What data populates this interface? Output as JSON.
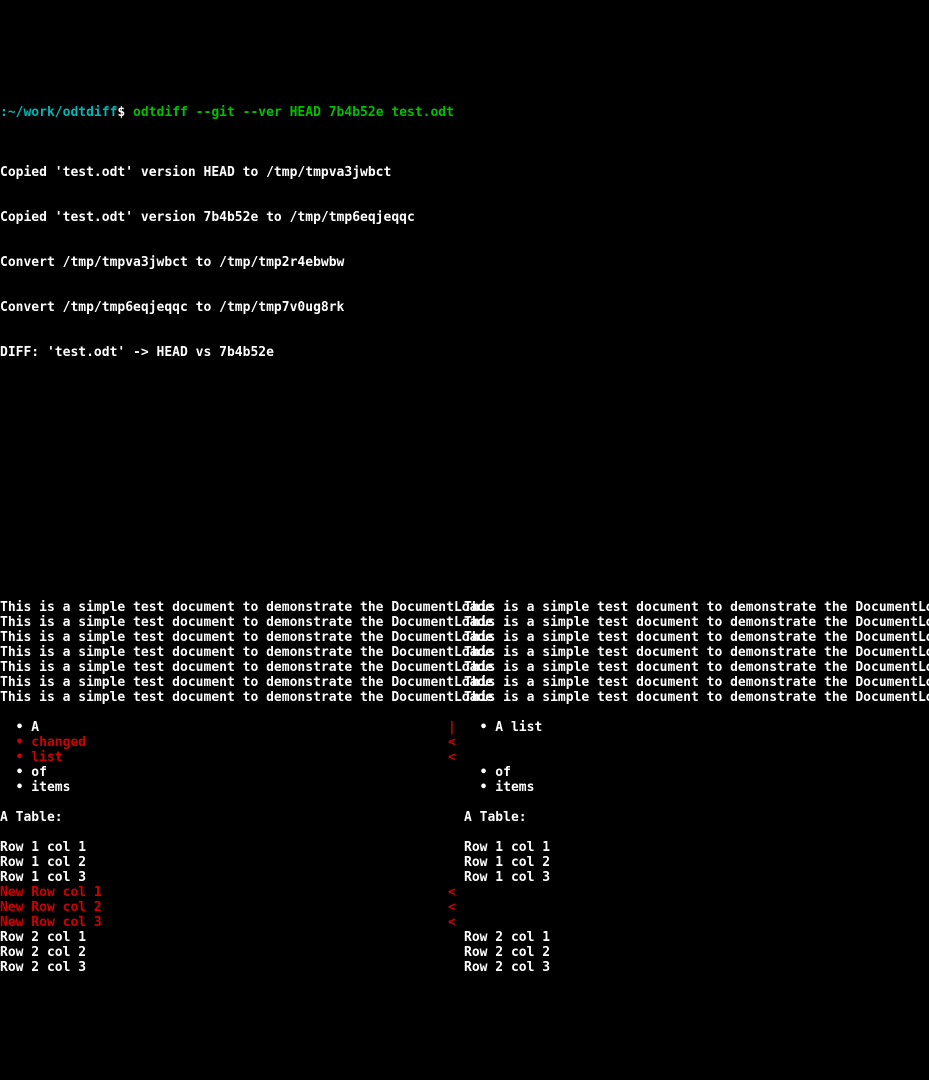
{
  "prompt": {
    "path": ":~/work/odtdiff",
    "dollar": "$",
    "command": " odtdiff --git --ver HEAD 7b4b52e test.odt"
  },
  "header": [
    "Copied 'test.odt' version HEAD to /tmp/tmpva3jwbct",
    "Copied 'test.odt' version 7b4b52e to /tmp/tmp6eqjeqqc",
    "Convert /tmp/tmpva3jwbct to /tmp/tmp2r4ebwbw",
    "Convert /tmp/tmp6eqjeqqc to /tmp/tmp7v0ug8rk",
    "DIFF: 'test.odt' -> HEAD vs 7b4b52e"
  ],
  "diff": {
    "rows": [
      {
        "left": "This is a simple test document to demonstrate the DocumentLoade",
        "sep": " ",
        "right": "This is a simple test document to demonstrate the DocumentLoade"
      },
      {
        "left": "This is a simple test document to demonstrate the DocumentLoade",
        "sep": " ",
        "right": "This is a simple test document to demonstrate the DocumentLoade"
      },
      {
        "left": "This is a simple test document to demonstrate the DocumentLoade",
        "sep": " ",
        "right": "This is a simple test document to demonstrate the DocumentLoade"
      },
      {
        "left": "This is a simple test document to demonstrate the DocumentLoade",
        "sep": " ",
        "right": "This is a simple test document to demonstrate the DocumentLoade"
      },
      {
        "left": "This is a simple test document to demonstrate the DocumentLoade",
        "sep": " ",
        "right": "This is a simple test document to demonstrate the DocumentLoade"
      },
      {
        "left": "This is a simple test document to demonstrate the DocumentLoade",
        "sep": " ",
        "right": "This is a simple test document to demonstrate the DocumentLoade"
      },
      {
        "left": "This is a simple test document to demonstrate the DocumentLoade",
        "sep": " ",
        "right": "This is a simple test document to demonstrate the DocumentLoade"
      },
      {
        "left": "",
        "sep": " ",
        "right": ""
      },
      {
        "left": "  • A",
        "sep": "|",
        "right": "  • A list",
        "sepColor": "red"
      },
      {
        "left": "  • changed",
        "leftColor": "red",
        "sep": "<",
        "right": "",
        "sepColor": "red"
      },
      {
        "left": "  • list",
        "leftColor": "red",
        "sep": "<",
        "right": "",
        "sepColor": "red"
      },
      {
        "left": "  • of",
        "sep": " ",
        "right": "  • of"
      },
      {
        "left": "  • items",
        "sep": " ",
        "right": "  • items"
      },
      {
        "left": "",
        "sep": " ",
        "right": ""
      },
      {
        "left": "A Table:",
        "sep": " ",
        "right": "A Table:"
      },
      {
        "left": "",
        "sep": " ",
        "right": ""
      },
      {
        "left": "Row 1 col 1",
        "sep": " ",
        "right": "Row 1 col 1"
      },
      {
        "left": "Row 1 col 2",
        "sep": " ",
        "right": "Row 1 col 2"
      },
      {
        "left": "Row 1 col 3",
        "sep": " ",
        "right": "Row 1 col 3"
      },
      {
        "left": "New Row col 1",
        "leftColor": "red",
        "sep": "<",
        "right": "",
        "sepColor": "red"
      },
      {
        "left": "New Row col 2",
        "leftColor": "red",
        "sep": "<",
        "right": "",
        "sepColor": "red"
      },
      {
        "left": "New Row col 3",
        "leftColor": "red",
        "sep": "<",
        "right": "",
        "sepColor": "red"
      },
      {
        "left": "Row 2 col 1",
        "sep": " ",
        "right": "Row 2 col 1"
      },
      {
        "left": "Row 2 col 2",
        "sep": " ",
        "right": "Row 2 col 2"
      },
      {
        "left": "Row 2 col 3",
        "sep": " ",
        "right": "Row 2 col 3"
      }
    ]
  }
}
